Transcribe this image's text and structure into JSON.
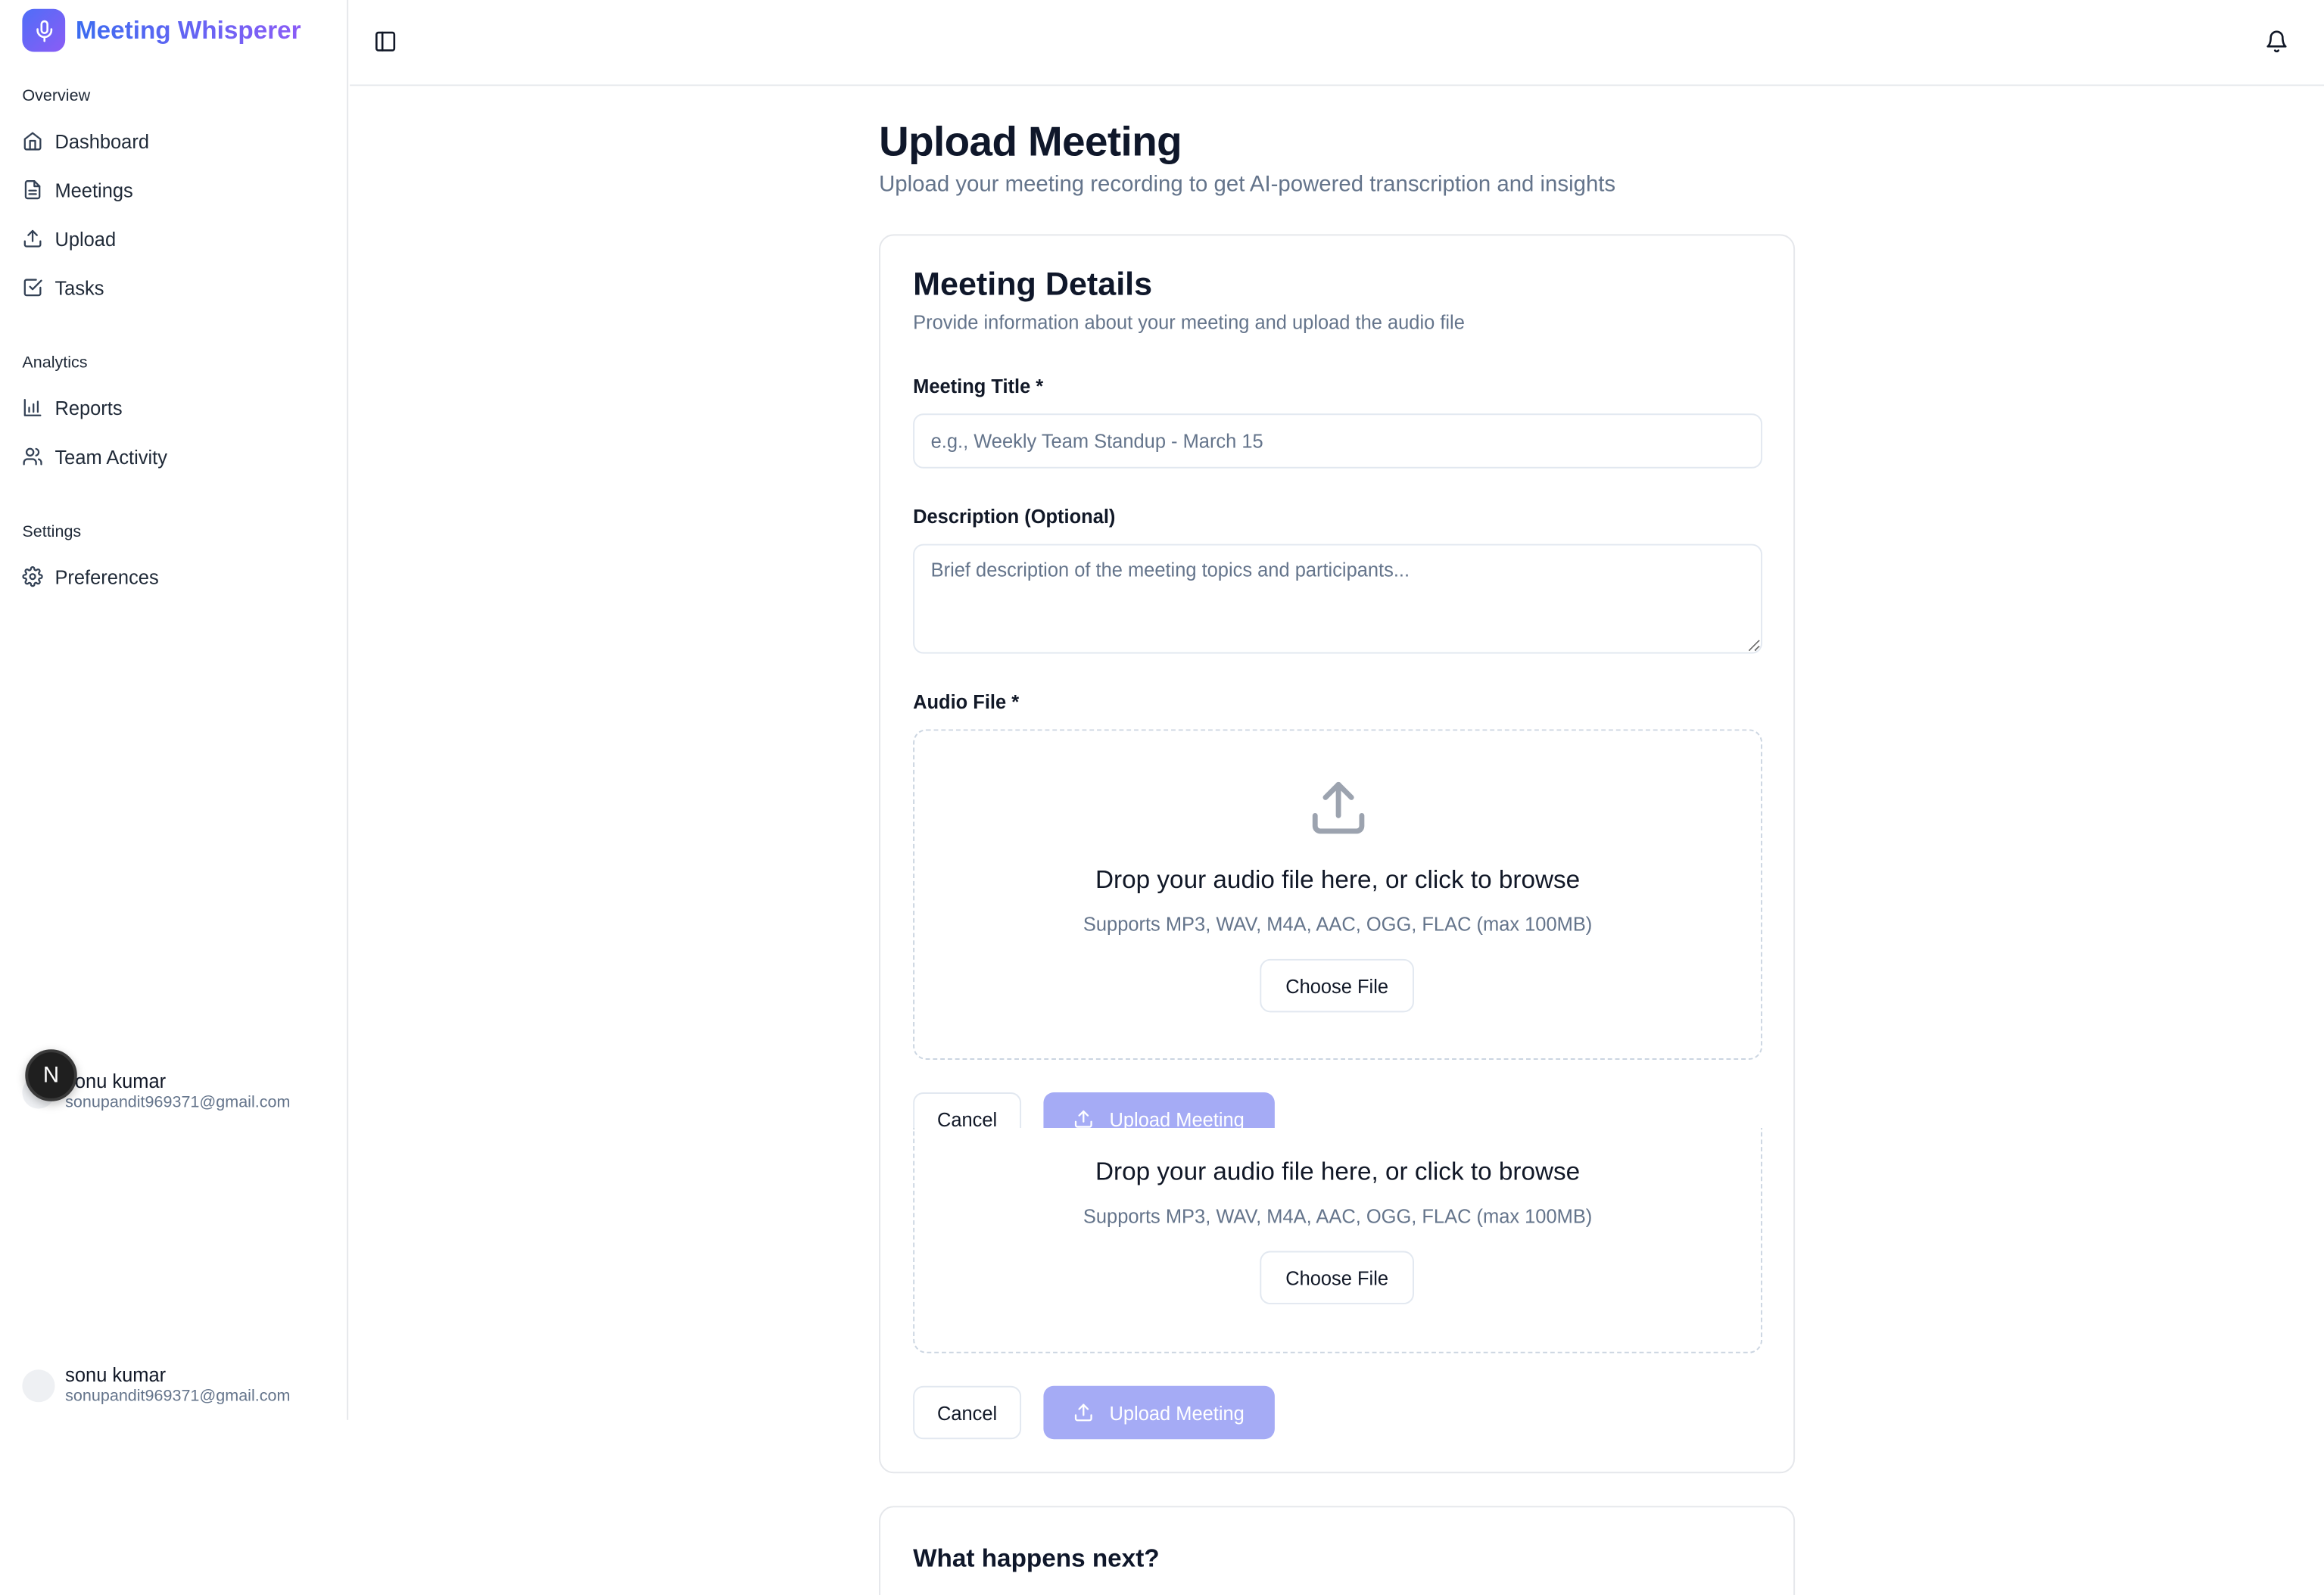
{
  "app": {
    "name": "Meeting Whisperer"
  },
  "sidebar": {
    "groups": [
      {
        "label": "Overview",
        "items": [
          {
            "label": "Dashboard",
            "icon": "home-icon"
          },
          {
            "label": "Meetings",
            "icon": "file-text-icon"
          },
          {
            "label": "Upload",
            "icon": "upload-icon"
          },
          {
            "label": "Tasks",
            "icon": "check-square-icon"
          }
        ]
      },
      {
        "label": "Analytics",
        "items": [
          {
            "label": "Reports",
            "icon": "bar-chart-icon"
          },
          {
            "label": "Team Activity",
            "icon": "users-icon"
          }
        ]
      },
      {
        "label": "Settings",
        "items": [
          {
            "label": "Preferences",
            "icon": "gear-icon"
          }
        ]
      }
    ],
    "user": {
      "name": "sonu kumar",
      "email": "sonupandit969371@gmail.com"
    },
    "badge": "N"
  },
  "page": {
    "title": "Upload Meeting",
    "subtitle": "Upload your meeting recording to get AI-powered transcription and insights"
  },
  "form": {
    "title": "Meeting Details",
    "description": "Provide information about your meeting and upload the audio file",
    "meeting_title_label": "Meeting Title *",
    "meeting_title_placeholder": "e.g., Weekly Team Standup - March 15",
    "description_label": "Description (Optional)",
    "description_placeholder": "Brief description of the meeting topics and participants...",
    "audio_label": "Audio File *",
    "drop_title": "Drop your audio file here, or click to browse",
    "drop_hint": "Supports MP3, WAV, M4A, AAC, OGG, FLAC (max 100MB)",
    "choose_file": "Choose File",
    "cancel": "Cancel",
    "upload": "Upload Meeting"
  },
  "next": {
    "title": "What happens next?"
  },
  "colors": {
    "brand_start": "#3b6cf0",
    "brand_end": "#8b5cf6",
    "primary_disabled": "#a5abf5"
  }
}
